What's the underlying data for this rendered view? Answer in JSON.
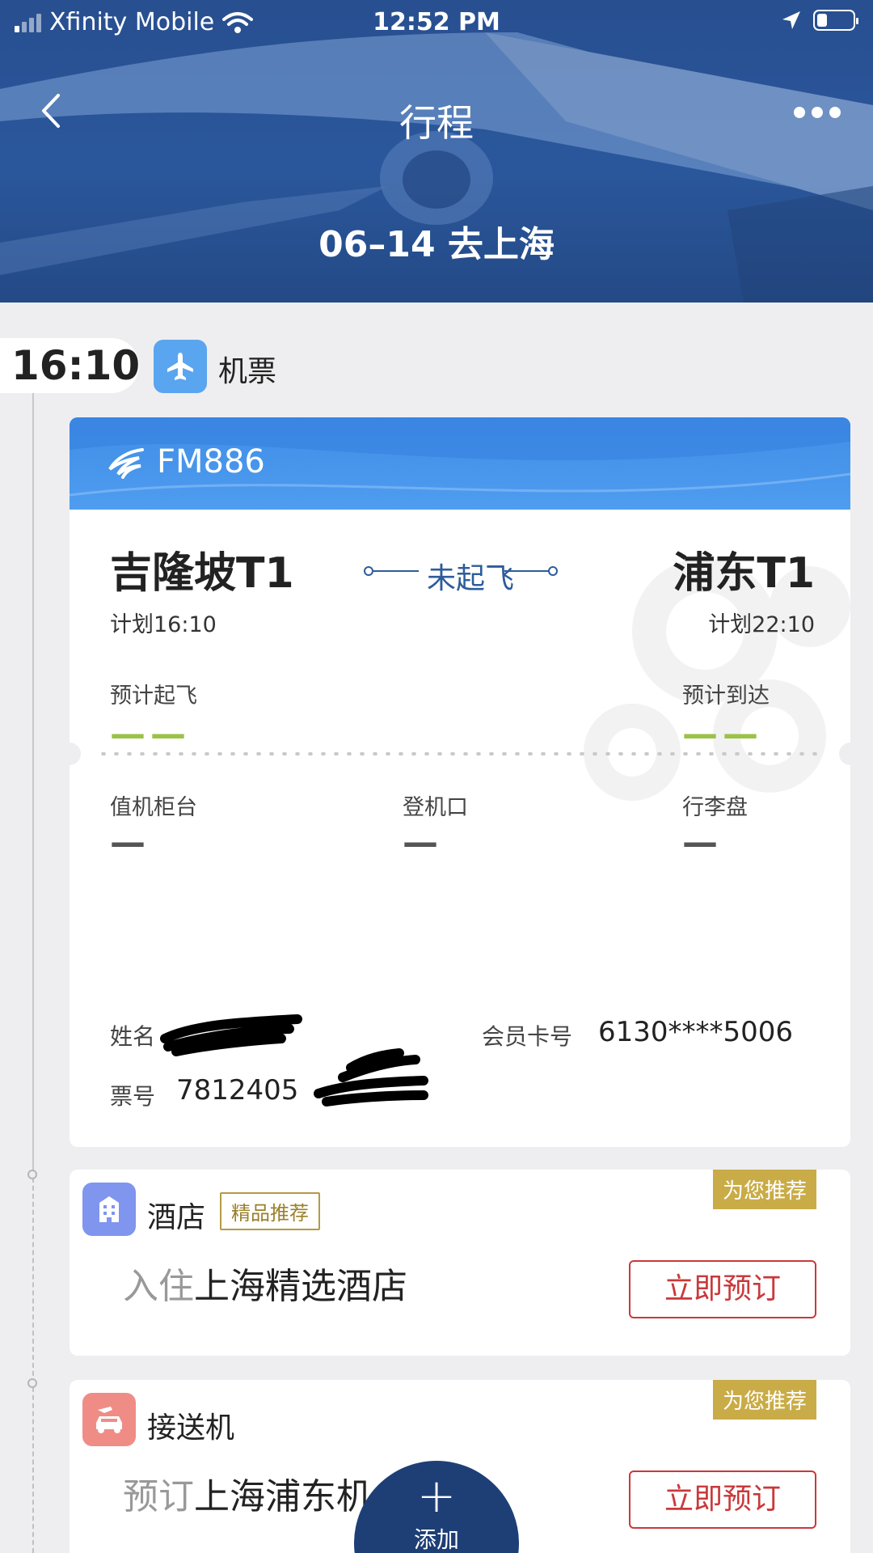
{
  "status_bar": {
    "carrier": "Xfinity Mobile",
    "time": "12:52 PM"
  },
  "nav": {
    "title": "行程",
    "back_icon": "chevron-left-icon",
    "more_icon": "more-dots-icon"
  },
  "trip": {
    "title": "06–14  去上海"
  },
  "flight_section": {
    "time": "16:10",
    "label": "机票",
    "icon": "airplane-icon",
    "icon_color": "#5aa5ef"
  },
  "flight": {
    "flight_no": "FM886",
    "departure_airport": "吉隆坡T1",
    "arrival_airport": "浦东T1",
    "status": "未起飞",
    "scheduled_departure": "计划16:10",
    "scheduled_arrival": "计划22:10",
    "est_departure_label": "预计起飞",
    "est_departure_value": "——",
    "est_arrival_label": "预计到达",
    "est_arrival_value": "——",
    "checkin_label": "值机柜台",
    "checkin_value": "—",
    "gate_label": "登机口",
    "gate_value": "—",
    "baggage_label": "行李盘",
    "baggage_value": "—",
    "name_label": "姓名",
    "member_label": "会员卡号",
    "member_value": "6130****5006",
    "ticket_label": "票号",
    "ticket_value": "7812405"
  },
  "hotel": {
    "badge": "为您推荐",
    "title": "酒店",
    "tag": "精品推荐",
    "line_muted": "入住",
    "line_strong": "上海精选酒店",
    "button": "立即预订",
    "icon": "hotel-building-icon",
    "icon_color": "#7f95ee"
  },
  "transfer": {
    "badge": "为您推荐",
    "title": "接送机",
    "line_muted": "预订",
    "line_strong": "上海浦东机",
    "button": "立即预订",
    "icon": "car-plane-icon",
    "icon_color": "#f08c86"
  },
  "fab": {
    "plus": "+",
    "label": "添加"
  }
}
